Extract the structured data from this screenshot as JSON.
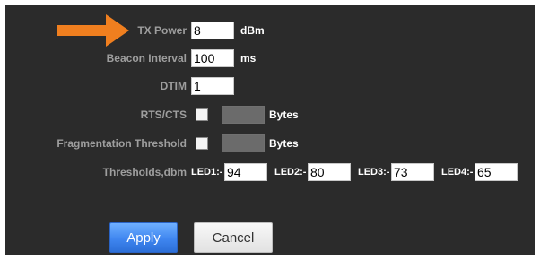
{
  "form": {
    "tx_power": {
      "label": "TX Power",
      "value": "8",
      "unit": "dBm"
    },
    "beacon_interval": {
      "label": "Beacon Interval",
      "value": "100",
      "unit": "ms"
    },
    "dtim": {
      "label": "DTIM",
      "value": "1"
    },
    "rts_cts": {
      "label": "RTS/CTS",
      "checked": false,
      "value": "",
      "unit": "Bytes"
    },
    "fragmentation_threshold": {
      "label": "Fragmentation Threshold",
      "checked": false,
      "value": "",
      "unit": "Bytes"
    },
    "thresholds": {
      "label": "Thresholds,dbm",
      "leds": [
        {
          "label": "LED1:-",
          "value": "94"
        },
        {
          "label": "LED2:-",
          "value": "80"
        },
        {
          "label": "LED3:-",
          "value": "73"
        },
        {
          "label": "LED4:-",
          "value": "65"
        }
      ]
    }
  },
  "buttons": {
    "apply": "Apply",
    "cancel": "Cancel"
  },
  "colors": {
    "panel_background": "#2b2b2b",
    "label_text": "#9e9e9e",
    "unit_text": "#ffffff",
    "apply_button": "#3f86f0",
    "annotation_arrow": "#f07f1f"
  },
  "annotation": {
    "icon": "arrow-right-icon"
  }
}
